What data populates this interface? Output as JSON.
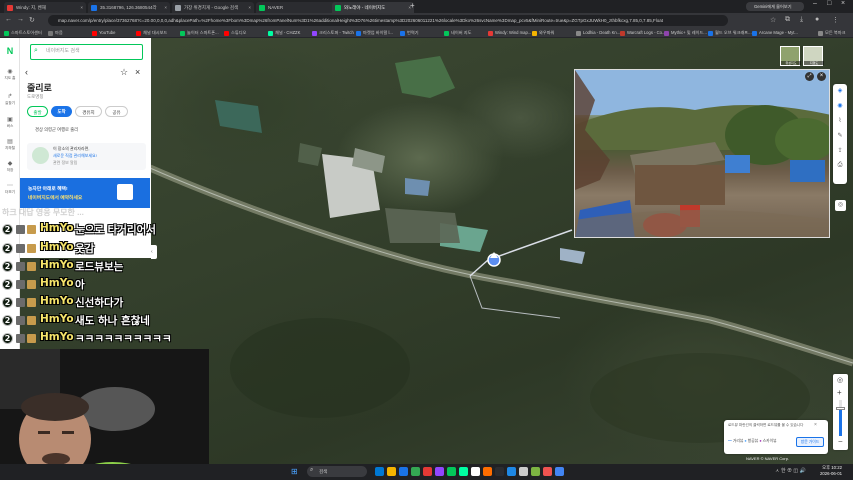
{
  "browser": {
    "tabs": [
      {
        "label": "Windy: 지, 벤재",
        "color": "#e53935",
        "active": false
      },
      {
        "label": "35.3168796, 126.3680544라",
        "color": "#1a73e8",
        "active": false
      },
      {
        "label": "가장 위경치게 - Google 검색",
        "color": "#9aa0a6",
        "active": false
      },
      {
        "label": "NAVER",
        "color": "#03c75a",
        "active": false
      },
      {
        "label": "와노래야 - 네이버지도",
        "color": "#03c75a",
        "active": true
      }
    ],
    "new_tab": "+",
    "gemini_label": "Gemini에게 물어보기",
    "url": "map.naver.com/p/entry/place/37362768?c=20.00,0,0,0,adh&placePath=%2Fhome%3Fbom%3Dmap%26fromPanelNum%3D1%26additionalHeight%3D76%26timestamp%3D202606011221%26locale%3Dko%26svcName%3Dmap_pcv5&fMiniRoute=true&p=ZGTpGxJUWkH0_zthbfkcxg,7.85,0,7.85,Float",
    "bookmarks": [
      {
        "label": "스마트스토어센터",
        "color": "#03c75a"
      },
      {
        "label": "마음",
        "color": "#777777"
      },
      {
        "label": "YouTube",
        "color": "#ff0000"
      },
      {
        "label": "채널 대시보드",
        "color": "#ff0000"
      },
      {
        "label": "놀이터 스마트폰...",
        "color": "#03c75a"
      },
      {
        "label": "스튜디오",
        "color": "#ff0000"
      },
      {
        "label": "채널 - CHZZK",
        "color": "#00ffa3"
      },
      {
        "label": "크리스토퍼 - Twitch",
        "color": "#9146ff"
      },
      {
        "label": "마켓업 바이럴 l...",
        "color": "#1a73e8"
      },
      {
        "label": "번역기",
        "color": "#1a73e8"
      },
      {
        "label": "네이버 지도",
        "color": "#03c75a"
      },
      {
        "label": "Windy: Wind map...",
        "color": "#e53935"
      },
      {
        "label": "와우파워",
        "color": "#f4b400"
      },
      {
        "label": "Lodhia - Death Kn...",
        "color": "#888888"
      },
      {
        "label": "Warcraft Logs - Co...",
        "color": "#c0392b"
      },
      {
        "label": "Mythic+ 및 레이드...",
        "color": "#8e44ad"
      },
      {
        "label": "월드 오브 워크래프...",
        "color": "#1a73e8"
      },
      {
        "label": "Arcane Mage - Myt...",
        "color": "#1a73e8"
      },
      {
        "label": "모든 북마크",
        "color": "#888888"
      }
    ]
  },
  "rail": {
    "items": [
      {
        "icon": "location-icon",
        "glyph": "◉",
        "label": "지도 홈"
      },
      {
        "icon": "directions-icon",
        "glyph": "↱",
        "label": "길찾기"
      },
      {
        "icon": "bus-icon",
        "glyph": "▣",
        "label": "버스"
      },
      {
        "icon": "train-icon",
        "glyph": "▤",
        "label": "지하철"
      },
      {
        "icon": "pin-icon",
        "glyph": "◆",
        "label": "저장"
      },
      {
        "icon": "more-icon",
        "glyph": "⋯",
        "label": "더보기"
      }
    ]
  },
  "panel": {
    "search_placeholder": "네이버지도 검색",
    "place_name": "줄리로",
    "place_category": "도로명칭",
    "buttons": {
      "start": "출발",
      "arrive": "도착",
      "waypoint": "경유지",
      "share": "공유"
    },
    "region_text": "경상 의령군 여행로 줄리",
    "promo_line1": "이 장소의 관리자라면,",
    "promo_line2": "새로운 직접 관리해보세요!",
    "promo_line3": "관련 정보 알림",
    "banner_line1": "농자만 아래로 혜택!",
    "banner_line2": "네이버지도에서 예약하세요"
  },
  "chat": {
    "faded_text": "하크 대답 영웅 무모한 ...",
    "messages": [
      {
        "nick": "HmYo",
        "text": "눈으로 타거리어서"
      },
      {
        "nick": "HmYo",
        "text": "웃감"
      },
      {
        "nick": "HmYo",
        "text": "로드뷰보는"
      },
      {
        "nick": "HmYo",
        "text": "아"
      },
      {
        "nick": "HmYo",
        "text": "신선하다가"
      },
      {
        "nick": "HmYo",
        "text": "새도 하나 흔찮네"
      },
      {
        "nick": "HmYo",
        "text": "ㅋㅋㅋㅋㅋㅋㅋㅋㅋㅋ"
      }
    ]
  },
  "map": {
    "minimap_labels": [
      "위성지도",
      "지형도"
    ],
    "legend_text": "로드뷰 파란선의 클릭하면 로드뷰를 볼 수 있습니다",
    "legend_items": [
      "거리뷰",
      "항공뷰",
      "스카이뷰"
    ],
    "legend_button": "방문 가이드",
    "footer": "NAVER © NAVER Corp."
  },
  "taskbar": {
    "search_placeholder": "검색",
    "tray_text": "ㅅ 한 ⊕ ◫ 🔊",
    "time": "오후 10:22",
    "date": "2026-06-01",
    "app_colors": [
      "#0078d4",
      "#f4b400",
      "#1a73e8",
      "#34a853",
      "#e53935",
      "#9146ff",
      "#03c75a",
      "#00ffa3",
      "#ffffff",
      "#ff6d00",
      "#2b2c30",
      "#1e88e5",
      "#cccccc",
      "#7cb342",
      "#ef5350",
      "#4285f4"
    ]
  }
}
